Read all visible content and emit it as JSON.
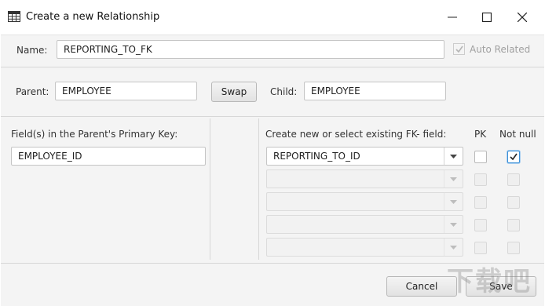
{
  "window": {
    "title": "Create a new Relationship",
    "icon": "table-icon"
  },
  "name_row": {
    "label": "Name:",
    "value": "REPORTING_TO_FK",
    "auto_related_label": "Auto Related",
    "auto_related_checked": true,
    "auto_related_enabled": false
  },
  "parent_row": {
    "parent_label": "Parent:",
    "parent_value": "EMPLOYEE",
    "swap_label": "Swap",
    "child_label": "Child:",
    "child_value": "EMPLOYEE"
  },
  "left_panel": {
    "heading": "Field(s) in the Parent's Primary Key:",
    "field_value": "EMPLOYEE_ID"
  },
  "right_panel": {
    "heading": "Create new or select existing FK- field:",
    "pk_header": "PK",
    "notnull_header": "Not null",
    "rows": [
      {
        "value": "REPORTING_TO_ID",
        "enabled": true,
        "pk": false,
        "not_null": true
      },
      {
        "value": "",
        "enabled": false,
        "pk": false,
        "not_null": false
      },
      {
        "value": "",
        "enabled": false,
        "pk": false,
        "not_null": false
      },
      {
        "value": "",
        "enabled": false,
        "pk": false,
        "not_null": false
      },
      {
        "value": "",
        "enabled": false,
        "pk": false,
        "not_null": false
      }
    ]
  },
  "footer": {
    "cancel_label": "Cancel",
    "save_label": "Save"
  },
  "watermark": "下载吧",
  "colors": {
    "accent": "#3b8fd6",
    "dialog_bg": "#f4f4f4"
  }
}
